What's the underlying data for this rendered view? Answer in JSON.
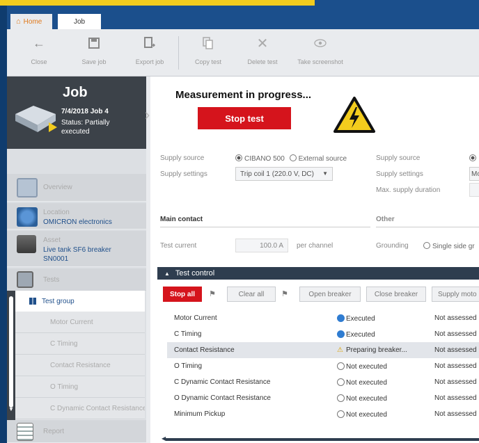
{
  "tabs": {
    "home": "Home",
    "job": "Job"
  },
  "ribbon": [
    {
      "label": "Close",
      "icon": "arrow-left-icon"
    },
    {
      "label": "Save job",
      "icon": "save-icon"
    },
    {
      "label": "Export job",
      "icon": "export-icon"
    },
    {
      "label": "Copy test",
      "icon": "copy-icon"
    },
    {
      "label": "Delete test",
      "icon": "delete-icon"
    },
    {
      "label": "Take screenshot",
      "icon": "eye-icon"
    }
  ],
  "job": {
    "title": "Job",
    "date": "7/4/2018 Job 4",
    "status": "Status: Partially executed"
  },
  "sidebar": {
    "overview": "Overview",
    "location_label": "Location",
    "location_value": "OMICRON electronics",
    "asset_label": "Asset",
    "asset_value1": "Live tank SF6 breaker",
    "asset_value2": "SN0001",
    "tests": "Tests",
    "report": "Report"
  },
  "testsnav": {
    "group": "Test group",
    "items": [
      "Motor Current",
      "C Timing",
      "Contact Resistance",
      "O Timing",
      "C Dynamic Contact Resistance"
    ]
  },
  "banner": {
    "message": "Measurement in progress...",
    "stop": "Stop test"
  },
  "settings": {
    "supply_source": "Supply source",
    "cibano": "CIBANO 500",
    "external": "External source",
    "supply_settings": "Supply settings",
    "trip_coil": "Trip coil 1 (220.0 V, DC)",
    "supply_source2": "Supply source",
    "supply_settings2": "Supply settings",
    "supply_settings2_value": "Mo",
    "max_duration": "Max. supply duration"
  },
  "main_contact": {
    "title": "Main contact",
    "other": "Other",
    "test_current": "Test current",
    "value": "100.0 A",
    "per_channel": "per channel",
    "grounding": "Grounding",
    "single_side": "Single side gr"
  },
  "test_control": {
    "title": "Test control",
    "stop_all": "Stop all",
    "clear_all": "Clear all",
    "open_breaker": "Open breaker",
    "close_breaker": "Close breaker",
    "supply_motor": "Supply moto",
    "rows": [
      {
        "name": "Motor Current",
        "status": "Executed",
        "assessment": "Not assessed"
      },
      {
        "name": "C Timing",
        "status": "Executed",
        "assessment": "Not assessed"
      },
      {
        "name": "Contact Resistance",
        "status": "Preparing breaker...",
        "assessment": "Not assessed"
      },
      {
        "name": "O Timing",
        "status": "Not executed",
        "assessment": "Not assessed"
      },
      {
        "name": "C Dynamic Contact Resistance",
        "status": "Not executed",
        "assessment": "Not assessed"
      },
      {
        "name": "O Dynamic Contact Resistance",
        "status": "Not executed",
        "assessment": "Not assessed"
      },
      {
        "name": "Minimum Pickup",
        "status": "Not executed",
        "assessment": "Not assessed"
      }
    ]
  },
  "colors": {
    "accent": "#d5141c",
    "brand": "#1b4f8c",
    "executed": "#2f7cd1",
    "warning": "#f3cc1d"
  }
}
